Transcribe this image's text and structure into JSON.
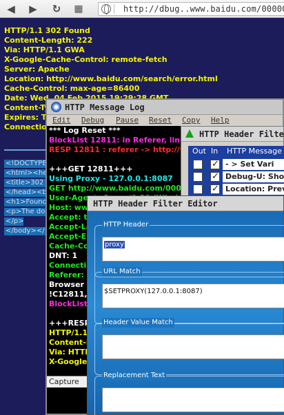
{
  "browser": {
    "url": "http://dbug..www.baidu.com/0000000"
  },
  "page": {
    "lines": [
      "HTTP/1.1 302 Found",
      "Content-Length: 222",
      "Via: HTTP/1.1 GWA",
      "X-Google-Cache-Control: remote-fetch",
      "Server: Apache",
      "Location: http://www.baidu.com/search/error.html",
      "Cache-Control: max-age=86400",
      "Date: Wed, 04 Feb 2015 19:29:28 GMT",
      "Content-Ty",
      "Expires: Th",
      "Connection"
    ],
    "source_lines": [
      "<!DOCTYPE",
      "<html><he",
      "<title>302 F",
      "</head><b",
      "<h1>Found",
      "<p>The doc",
      "</p>",
      "</body></"
    ]
  },
  "log_window": {
    "title": "HTTP Message Log",
    "menu": [
      "Edit",
      "Debug",
      "Pause",
      "Reset",
      "Copy",
      "Help"
    ],
    "lines": [
      {
        "text": "*** Log Reset ***",
        "color": "white"
      },
      {
        "text": "BlockList 12811: in Referer, line 8",
        "color": "magenta"
      },
      {
        "text": "RESP 12811 : referer -> http://ww",
        "color": "red"
      },
      {
        "text": "",
        "color": "white"
      },
      {
        "text": "+++GET 12811+++",
        "color": "white"
      },
      {
        "text": "Using Proxy - 127.0.0.1:8087",
        "color": "cyan"
      },
      {
        "text": "GET http://www.baidu.com/0000",
        "color": "green"
      },
      {
        "text": "User-Agent: Opera/9.80 (Window",
        "color": "green"
      },
      {
        "text": "Host: www",
        "color": "green"
      },
      {
        "text": "Accept: t",
        "color": "green"
      },
      {
        "text": "Accept-La",
        "color": "green"
      },
      {
        "text": "Accept-En",
        "color": "green"
      },
      {
        "text": "Cache-Co",
        "color": "green"
      },
      {
        "text": "DNT: 1",
        "color": "white"
      },
      {
        "text": "Connection",
        "color": "green"
      },
      {
        "text": "Referer: h",
        "color": "green"
      },
      {
        "text": "Browser r",
        "color": "white"
      },
      {
        "text": "!C12811,",
        "color": "white"
      },
      {
        "text": "BlockList",
        "color": "magenta"
      },
      {
        "text": "",
        "color": "white"
      },
      {
        "text": "+++RESP",
        "color": "white"
      },
      {
        "text": "HTTP/1.1",
        "color": "yellow"
      },
      {
        "text": "Content-L",
        "color": "yellow"
      },
      {
        "text": "Via: HTTP",
        "color": "yellow"
      },
      {
        "text": "X-Google",
        "color": "yellow"
      }
    ],
    "capture_label": "Capture"
  },
  "filter_window": {
    "title": "HTTP Header Filter",
    "col_out": "Out",
    "col_in": "In",
    "col_msg": "HTTP Message H",
    "rows": [
      {
        "out": false,
        "in": true,
        "text": "-      > Set Vari"
      },
      {
        "out": false,
        "in": true,
        "text": "Debug-U: Show"
      },
      {
        "out": false,
        "in": true,
        "text": "Location: Prev"
      }
    ]
  },
  "editor_window": {
    "title": "HTTP Header Filter Editor",
    "header_label": "HTTP Header",
    "header_value": "proxy",
    "url_match_label": "URL Match",
    "url_match_value": "$SETPROXY(127.0.0.1:8087)",
    "header_value_match_label": "Header Value Match",
    "header_value_match_value": "",
    "replacement_label": "Replacement Text",
    "replacement_value": ""
  }
}
